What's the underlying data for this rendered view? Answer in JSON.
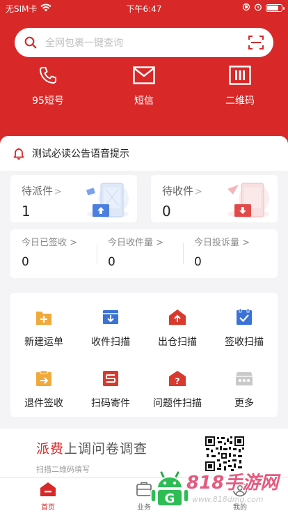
{
  "status_bar": {
    "carrier": "无SIM卡",
    "time": "下午6:47",
    "battery_level": 0.85
  },
  "search": {
    "placeholder": "全网包裹一键查询"
  },
  "quick_actions": [
    {
      "label": "95短号",
      "icon": "phone-icon"
    },
    {
      "label": "短信",
      "icon": "mail-icon"
    },
    {
      "label": "二维码",
      "icon": "qrcode-icon"
    }
  ],
  "notice": {
    "text": "测试必读公告语音提示"
  },
  "cards": [
    {
      "title": "待派件",
      "chevron": ">",
      "count": "1"
    },
    {
      "title": "待收件",
      "chevron": ">",
      "count": "0"
    }
  ],
  "stats": [
    {
      "label": "今日已签收",
      "chevron": ">",
      "value": "0"
    },
    {
      "label": "今日收件量",
      "chevron": ">",
      "value": "0"
    },
    {
      "label": "今日投诉量",
      "chevron": ">",
      "value": "0"
    }
  ],
  "grid": [
    {
      "label": "新建运单",
      "icon": "new-waybill-icon",
      "color": "#f0a93b"
    },
    {
      "label": "收件扫描",
      "icon": "receive-scan-icon",
      "color": "#3a72d8"
    },
    {
      "label": "出仓扫描",
      "icon": "outbound-scan-icon",
      "color": "#d83a2e"
    },
    {
      "label": "签收扫描",
      "icon": "sign-scan-icon",
      "color": "#3a72d8"
    },
    {
      "label": "退件签收",
      "icon": "return-sign-icon",
      "color": "#f0a93b"
    },
    {
      "label": "扫码寄件",
      "icon": "scan-send-icon",
      "color": "#d83a2e"
    },
    {
      "label": "问题件扫描",
      "icon": "problem-scan-icon",
      "color": "#d83a2e"
    },
    {
      "label": "更多",
      "icon": "more-icon",
      "color": "#b8b8b8"
    }
  ],
  "banner": {
    "title_accent": "派费",
    "title_rest": "上调问卷调查",
    "subtitle": "扫描二维码填写"
  },
  "tabs": [
    {
      "label": "首页",
      "icon": "home-icon",
      "active": true
    },
    {
      "label": "业务",
      "icon": "business-icon",
      "active": false
    },
    {
      "label": "我的",
      "icon": "profile-icon",
      "active": false
    }
  ],
  "watermark": {
    "text": "818手游网",
    "url": "www.818dmg.com"
  },
  "colors": {
    "brand": "#d82828",
    "background": "#f4f4f6"
  }
}
